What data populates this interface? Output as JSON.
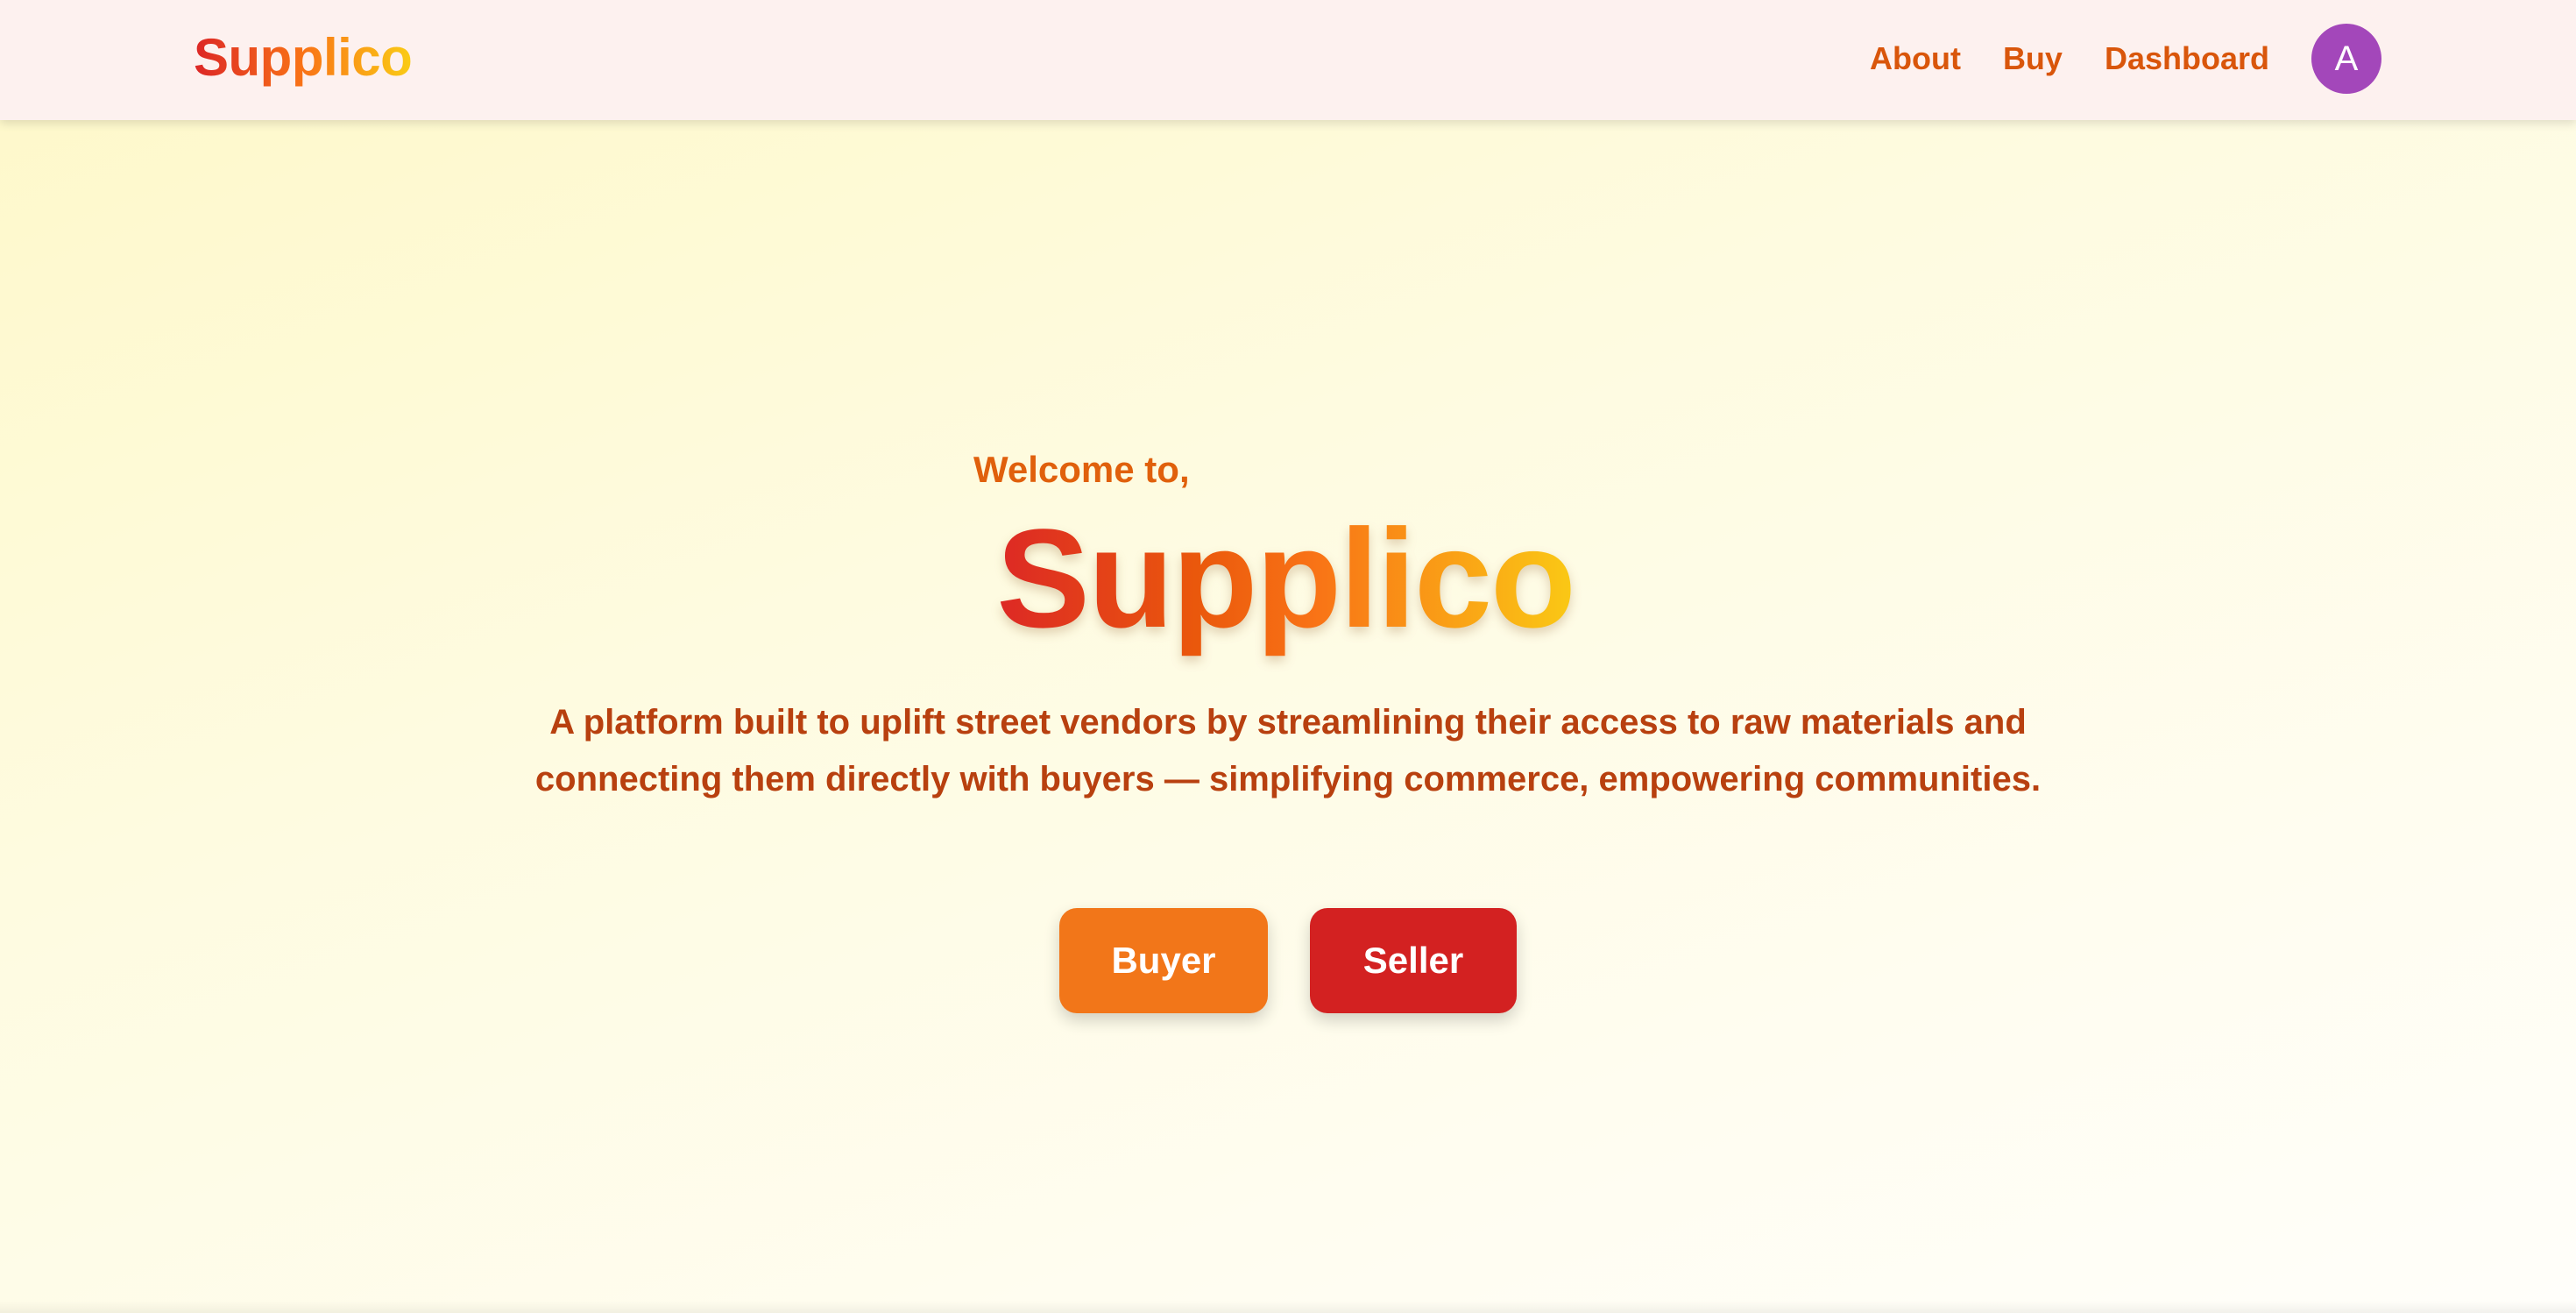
{
  "navbar": {
    "brand": "Supplico",
    "links": [
      "About",
      "Buy",
      "Dashboard"
    ],
    "avatar_initial": "A"
  },
  "hero": {
    "welcome": "Welcome to,",
    "title": "Supplico",
    "description_lines": [
      "A platform built to uplift street vendors by streamlining their access to raw materials and",
      "connecting them directly with buyers — simplifying commerce, empowering communities."
    ],
    "buttons": {
      "buyer": "Buyer",
      "seller": "Seller"
    }
  },
  "colors": {
    "nav_background": "#fdf1ef",
    "nav_link": "#d9560b",
    "avatar_background": "#a347ba",
    "brand_gradient": [
      "#dc2626",
      "#f97316",
      "#facc15"
    ],
    "welcome_text": "#e0600c",
    "description_text": "#b8400f",
    "buyer_button": "#f27619",
    "seller_button": "#d32121",
    "page_background": "#fefbe0"
  }
}
